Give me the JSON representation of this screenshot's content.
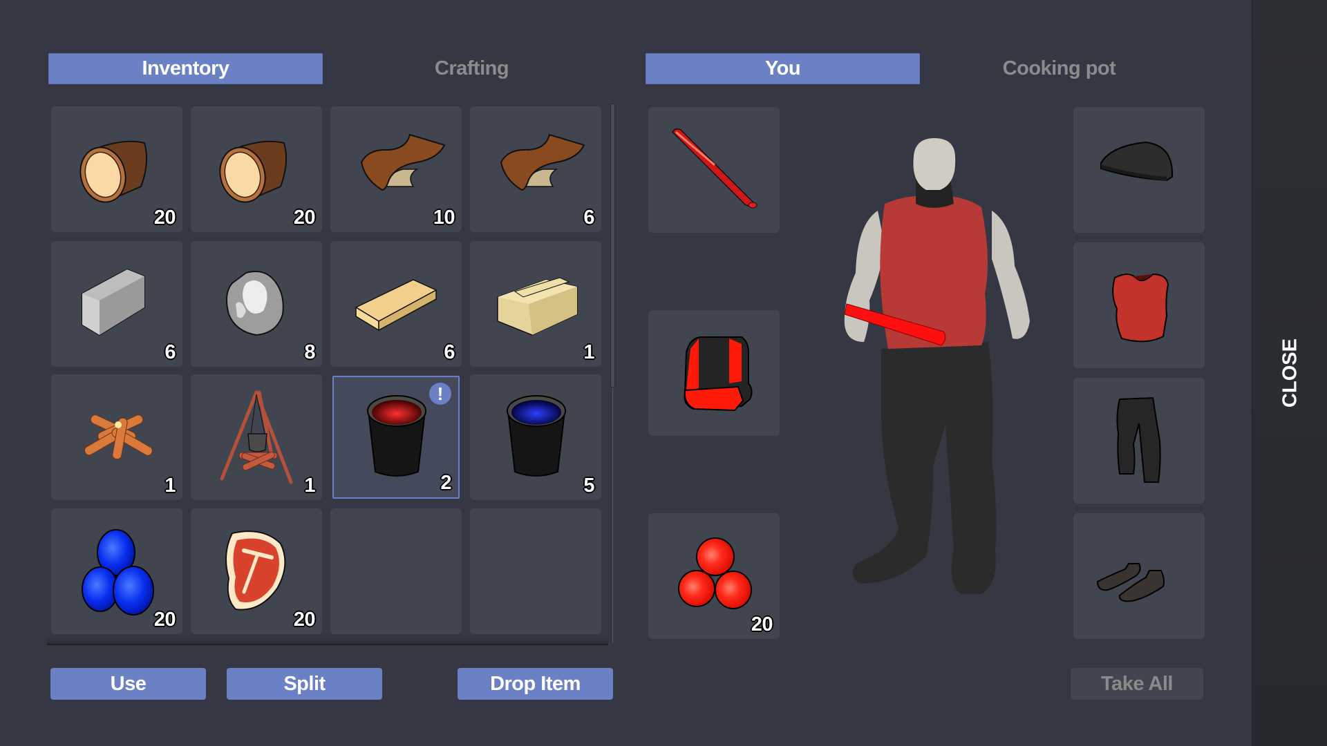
{
  "tabs": {
    "inventory": "Inventory",
    "crafting": "Crafting",
    "you": "You",
    "cooking_pot": "Cooking pot"
  },
  "colors": {
    "accent": "#6b80c5",
    "background": "#353843",
    "slot": "#41454f",
    "close_panel": "#2a2d32",
    "inactive_text": "#8c8c8c"
  },
  "inventory": {
    "slots": [
      {
        "item": "wooden-log",
        "count": "20"
      },
      {
        "item": "wooden-log",
        "count": "20"
      },
      {
        "item": "leather",
        "count": "10"
      },
      {
        "item": "leather",
        "count": "6"
      },
      {
        "item": "iron-ingot",
        "count": "6"
      },
      {
        "item": "silver-ore",
        "count": "8"
      },
      {
        "item": "wooden-plank",
        "count": "6"
      },
      {
        "item": "wooden-crate",
        "count": "1"
      },
      {
        "item": "campfire",
        "count": "1"
      },
      {
        "item": "cooking-tripod",
        "count": "1"
      },
      {
        "item": "bucket-red",
        "count": "2",
        "selected": true,
        "badge": "!"
      },
      {
        "item": "bucket-blue",
        "count": "5"
      },
      {
        "item": "blue-berries",
        "count": "20"
      },
      {
        "item": "raw-steak",
        "count": "20"
      },
      {
        "item": "empty",
        "count": ""
      },
      {
        "item": "empty",
        "count": ""
      }
    ]
  },
  "equipment": {
    "weapon": {
      "item": "baseball-bat"
    },
    "backpack": {
      "item": "backpack"
    },
    "consumable": {
      "item": "red-berries",
      "count": "20"
    },
    "head": {
      "item": "beanie"
    },
    "chest": {
      "item": "tank-top"
    },
    "legs": {
      "item": "pants"
    },
    "feet": {
      "item": "shoes"
    }
  },
  "buttons": {
    "use": "Use",
    "split": "Split",
    "drop": "Drop Item",
    "take_all": "Take All",
    "close": "CLOSE"
  }
}
